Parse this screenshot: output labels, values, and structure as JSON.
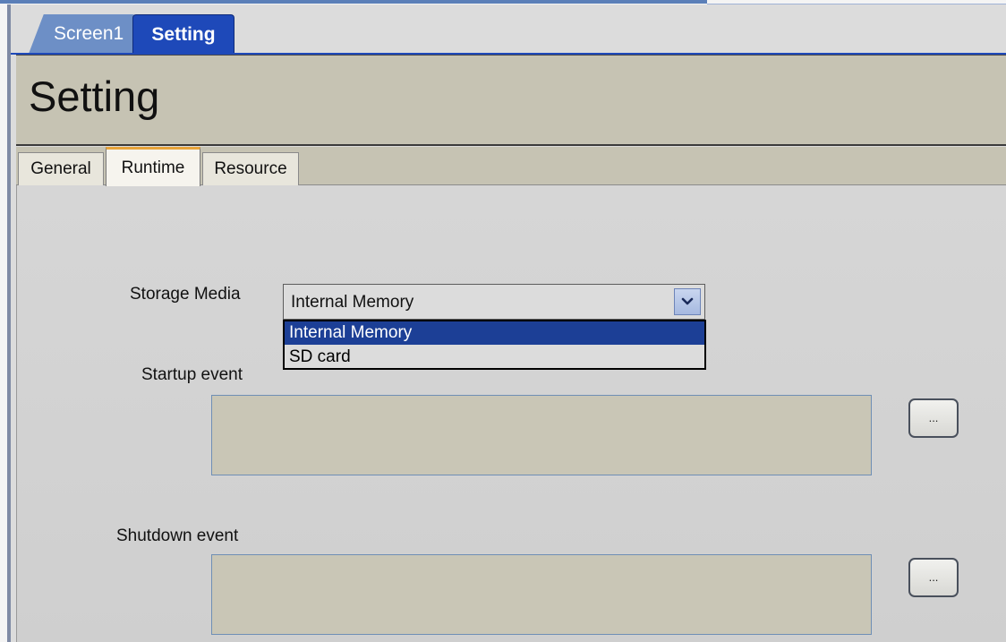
{
  "document_tabs": [
    {
      "label": "Screen1"
    },
    {
      "label": "Setting"
    }
  ],
  "page_title": "Setting",
  "settings_tabs": [
    {
      "label": "General"
    },
    {
      "label": "Runtime"
    },
    {
      "label": "Resource"
    }
  ],
  "runtime": {
    "storage_media_label": "Storage Media",
    "storage_media_value": "Internal Memory",
    "storage_media_options": [
      "Internal Memory",
      "SD card"
    ],
    "startup_event_label": "Startup event",
    "startup_event_value": "",
    "startup_browse_label": "...",
    "shutdown_event_label": "Shutdown event",
    "shutdown_event_value": "",
    "shutdown_browse_label": "..."
  },
  "icons": {
    "dropdown_arrow": "chevron-down-icon"
  },
  "colors": {
    "active_doc_tab": "#1e49b9",
    "selected_option": "#1c3f96",
    "header_panel": "#c6c3b3",
    "runtime_tab_accent": "#e8a43a"
  }
}
